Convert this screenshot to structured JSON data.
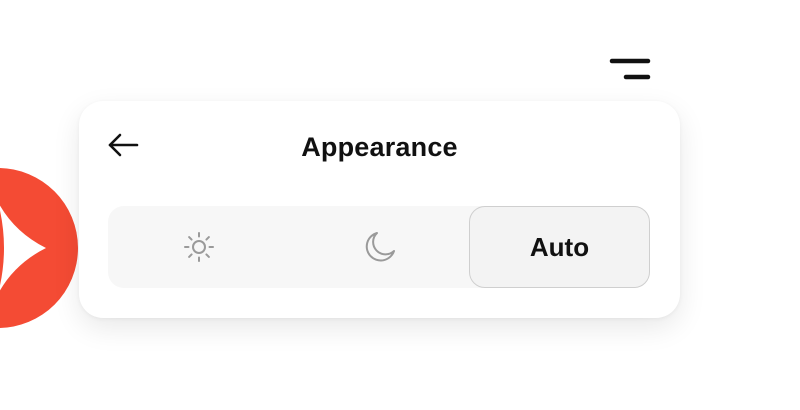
{
  "header": {
    "menu_icon": "menu-icon"
  },
  "brand": {
    "logo_icon": "brand-logo",
    "color": "#f44b34"
  },
  "panel": {
    "back_icon": "arrow-left-icon",
    "title": "Appearance",
    "theme_options": [
      {
        "id": "light",
        "icon": "sun-icon",
        "label": "",
        "selected": false
      },
      {
        "id": "dark",
        "icon": "moon-icon",
        "label": "",
        "selected": false
      },
      {
        "id": "auto",
        "icon": "",
        "label": "Auto",
        "selected": true
      }
    ]
  },
  "colors": {
    "background": "#ffffff",
    "panel": "#ffffff",
    "track": "#f7f7f7",
    "selected_segment": "#f3f3f3",
    "selected_border": "#cfcfcf",
    "icon_gray": "#9a9a9a",
    "text": "#111111"
  }
}
